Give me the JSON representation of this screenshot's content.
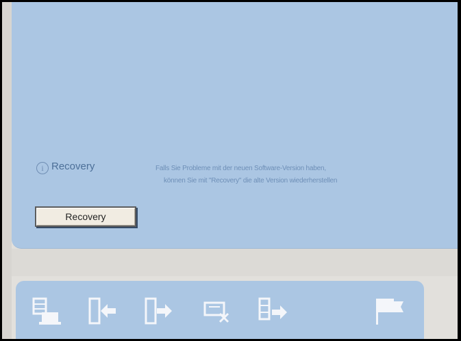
{
  "recovery": {
    "title": "Recovery",
    "description_line1": "Falls Sie Probleme mit der neuen Software-Version haben,",
    "description_line2": "können Sie mit \"Recovery\" die alte Version wiederherstellen",
    "button_label": "Recovery"
  },
  "toolbar": {
    "icons": [
      "host-computer-icon",
      "import-icon",
      "export-icon",
      "disconnect-icon",
      "transfer-icon",
      "flag-icon"
    ]
  },
  "colors": {
    "panel_blue": "#abc6e3",
    "background_gray": "#e2e0dc",
    "icon_white": "#f4f6fa"
  }
}
